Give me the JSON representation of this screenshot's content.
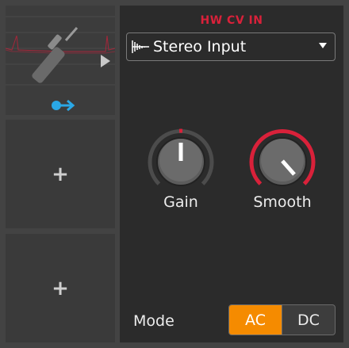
{
  "device": {
    "title": "HW CV IN"
  },
  "input_select": {
    "value": "Stereo Input",
    "icon": "waveform-icon",
    "caret_icon": "caret-down-icon"
  },
  "knobs": [
    {
      "label": "Gain",
      "level": 0.5,
      "modulation_color": "#d9213a"
    },
    {
      "label": "Smooth",
      "level": 0.87,
      "arc_color": "#d9213a"
    }
  ],
  "mode": {
    "label": "Mode",
    "options": [
      "AC",
      "DC"
    ],
    "selected": "AC",
    "active_color": "#f58b00"
  },
  "slots": {
    "add_icon": "+",
    "modulator_icon": "cable-plug-icon",
    "route_icon": "arrow-right-icon",
    "accent_color": "#2aa8e6",
    "scope_color": "#c0203a"
  }
}
